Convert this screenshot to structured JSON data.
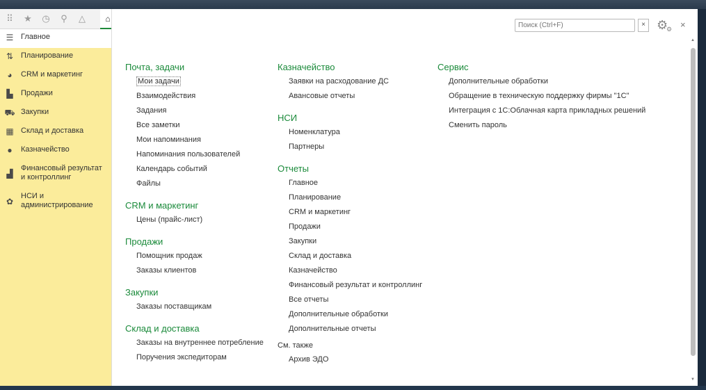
{
  "quickbar": {
    "icons": [
      "apps-icon",
      "star-icon",
      "history-icon",
      "search-icon",
      "bell-icon"
    ],
    "home_icon": "home-icon"
  },
  "sidebar": {
    "items": [
      {
        "label": "Главное",
        "icon": "menu-icon",
        "active": true
      },
      {
        "label": "Планирование",
        "icon": "planning-icon"
      },
      {
        "label": "CRM и маркетинг",
        "icon": "pie-icon"
      },
      {
        "label": "Продажи",
        "icon": "bag-icon"
      },
      {
        "label": "Закупки",
        "icon": "cart-icon"
      },
      {
        "label": "Склад и доставка",
        "icon": "warehouse-icon"
      },
      {
        "label": "Казначейство",
        "icon": "coin-icon"
      },
      {
        "label": "Финансовый результат и контроллинг",
        "icon": "bar-chart-icon"
      },
      {
        "label": "НСИ и администрирование",
        "icon": "gear-icon"
      }
    ]
  },
  "header": {
    "search_placeholder": "Поиск (Ctrl+F)",
    "clear_label": "×",
    "close_label": "×"
  },
  "columns": {
    "col1": {
      "groups": [
        {
          "title": "Почта, задачи",
          "links": [
            "Мои задачи",
            "Взаимодействия",
            "Задания",
            "Все заметки",
            "Мои напоминания",
            "Напоминания пользователей",
            "Календарь событий",
            "Файлы"
          ]
        },
        {
          "title": "CRM и маркетинг",
          "links": [
            "Цены (прайс-лист)"
          ]
        },
        {
          "title": "Продажи",
          "links": [
            "Помощник продаж",
            "Заказы клиентов"
          ]
        },
        {
          "title": "Закупки",
          "links": [
            "Заказы поставщикам"
          ]
        },
        {
          "title": "Склад и доставка",
          "links": [
            "Заказы на внутреннее потребление",
            "Поручения экспедиторам"
          ]
        }
      ]
    },
    "col2": {
      "groups": [
        {
          "title": "Казначейство",
          "links": [
            "Заявки на расходование ДС",
            "Авансовые отчеты"
          ]
        },
        {
          "title": "НСИ",
          "links": [
            "Номенклатура",
            "Партнеры"
          ]
        },
        {
          "title": "Отчеты",
          "links": [
            "Главное",
            "Планирование",
            "CRM и маркетинг",
            "Продажи",
            "Закупки",
            "Склад и доставка",
            "Казначейство",
            "Финансовый результат и контроллинг",
            "Все отчеты",
            "Дополнительные обработки",
            "Дополнительные отчеты"
          ]
        }
      ],
      "see_also": {
        "title": "См. также",
        "links": [
          "Архив ЭДО"
        ]
      }
    },
    "col3": {
      "groups": [
        {
          "title": "Сервис",
          "links": [
            "Дополнительные обработки",
            "Обращение в техническую поддержку фирмы \"1С\"",
            "Интеграция с 1С:Облачная карта прикладных решений",
            "Сменить пароль"
          ]
        }
      ]
    }
  }
}
